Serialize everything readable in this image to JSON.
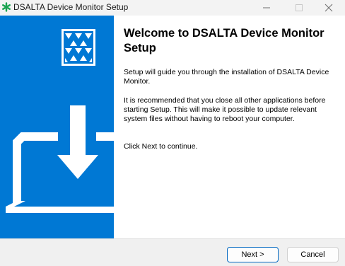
{
  "window": {
    "title": "DSALTA Device Monitor Setup",
    "app_icon": "green-asterisk-icon",
    "controls": [
      "minimize-icon",
      "maximize-icon",
      "close-icon"
    ]
  },
  "sidebar": {
    "background_color": "#0078d4",
    "logo": "dsalta-logo-icon",
    "illustration": "laptop-download-icon"
  },
  "content": {
    "heading": "Welcome to DSALTA Device Monitor Setup",
    "paragraph1": "Setup will guide you through the installation of DSALTA Device Monitor.",
    "paragraph2": "It is recommended that you close all other applications before starting Setup. This will make it possible to update relevant system files without having to reboot your computer.",
    "paragraph3": "Click Next to continue."
  },
  "buttons": {
    "next_label": "Next >",
    "cancel_label": "Cancel"
  },
  "colors": {
    "accent": "#0078d4",
    "icon_green": "#1aa350"
  }
}
